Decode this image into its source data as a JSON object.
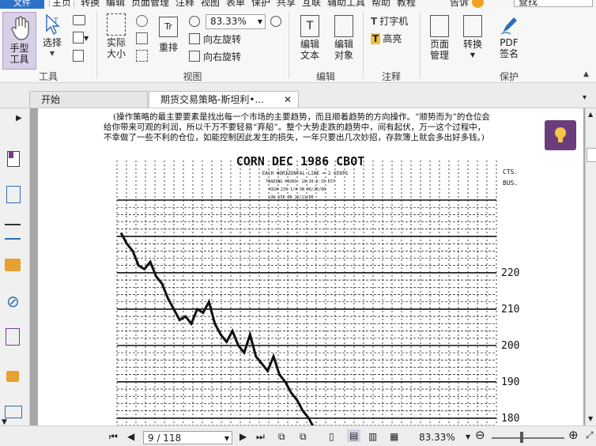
{
  "menubar": {
    "file": "文件",
    "items": [
      "主页",
      "转换",
      "编辑",
      "页面管理",
      "注释",
      "视图",
      "表单",
      "保护",
      "共享",
      "互联",
      "辅助工具",
      "帮助",
      "教程"
    ],
    "tell_me": "告诉",
    "search_placeholder": "查找"
  },
  "ribbon": {
    "hand_tool": "手型\n工具",
    "select": "选择",
    "actual_size": "实际\n大小",
    "reflow": "重排",
    "zoom_value": "83.33%",
    "rotate_left": "向左旋转",
    "rotate_right": "向右旋转",
    "edit_text": "编辑\n文本",
    "edit_object": "编辑\n对象",
    "typewriter": "打字机",
    "highlight": "高亮",
    "page_manage": "页面\n管理",
    "convert": "转换",
    "pdf_sign": "PDF\n签名",
    "groups": [
      "工具",
      "视图",
      "编辑",
      "注释",
      "保护"
    ]
  },
  "tabs": [
    {
      "label": "开始"
    },
    {
      "label": "期货交易策略-斯坦利•...",
      "close": "✕"
    }
  ],
  "document": {
    "paragraph": [
      "(操作策略的最主要要素是找出每一个市场的主要趋势，而且顺着趋势的方向操作。“顺势而为”的仓位会",
      "给你带来可观的利润，所以千万不要轻易“弃船”。整个大势走跌的趋势中，间有起伏，万一这个过程中，",
      "不幸做了一些不利的仓位，如能控制因此发生的损失，一年只要出几次妙招，存款簿上就会多出好多钱。)"
    ],
    "chart": {
      "title": "CORN DEC 1986 CBOT",
      "sub1": "EACH HORIZONTAL LINE = 2 CENTS",
      "sub2": "TRADING HOURS: 10:30-2:15 EST",
      "sub3": "HIGH 235 1/4 ON 06/25/86",
      "sub4": "LOW 158 ON 12/11/86",
      "unit_top": "CTS.",
      "unit_bottom": "BUS.",
      "ticks": [
        "220",
        "210",
        "200",
        "190",
        "180"
      ]
    }
  },
  "chart_data": {
    "type": "line",
    "title": "CORN DEC 1986 CBOT",
    "ylabel": "CTS. BUS.",
    "yticks": [
      220,
      210,
      200,
      190,
      180
    ],
    "ylim": [
      178,
      240
    ],
    "series": [
      {
        "values": [
          231,
          228,
          226,
          222,
          221,
          223,
          219,
          217,
          213,
          210,
          207,
          208,
          206,
          210,
          209,
          212,
          206,
          203,
          201,
          204,
          200,
          198,
          203,
          197,
          195,
          193,
          197,
          192,
          190,
          187,
          185,
          182,
          180,
          177
        ]
      }
    ]
  },
  "statusbar": {
    "page": "9 / 118",
    "zoom": "83.33%"
  }
}
